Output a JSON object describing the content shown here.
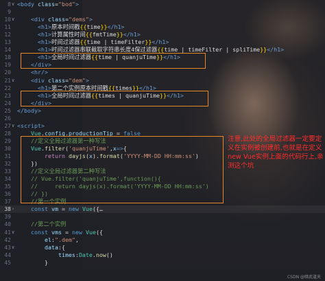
{
  "editor": {
    "lines": [
      {
        "n": "8",
        "fold": "∨",
        "segs": [
          {
            "c": "t",
            "v": "<body"
          },
          {
            "c": "a",
            "v": " class"
          },
          {
            "c": "tx",
            "v": "="
          },
          {
            "c": "s",
            "v": "\"bod\""
          },
          {
            "c": "t",
            "v": ">"
          }
        ]
      },
      {
        "n": "9",
        "fold": "",
        "segs": []
      },
      {
        "n": "10",
        "fold": "∨",
        "segs": [
          {
            "c": "tx",
            "v": "    "
          },
          {
            "c": "t",
            "v": "<div"
          },
          {
            "c": "a",
            "v": " class"
          },
          {
            "c": "tx",
            "v": "="
          },
          {
            "c": "s",
            "v": "\"dems\""
          },
          {
            "c": "t",
            "v": ">"
          }
        ]
      },
      {
        "n": "11",
        "fold": "",
        "segs": [
          {
            "c": "tx",
            "v": "      "
          },
          {
            "c": "t",
            "v": "<h1>"
          },
          {
            "c": "tx",
            "v": "原本时间戳"
          },
          {
            "c": "br",
            "v": "{{"
          },
          {
            "c": "tx",
            "v": "time"
          },
          {
            "c": "br",
            "v": "}}"
          },
          {
            "c": "t",
            "v": "</h1>"
          }
        ]
      },
      {
        "n": "12",
        "fold": "",
        "segs": [
          {
            "c": "tx",
            "v": "      "
          },
          {
            "c": "t",
            "v": "<h1>"
          },
          {
            "c": "tx",
            "v": "计算属性时间"
          },
          {
            "c": "br",
            "v": "{{"
          },
          {
            "c": "tx",
            "v": "fmtTime"
          },
          {
            "c": "br",
            "v": "}}"
          },
          {
            "c": "t",
            "v": "</h1>"
          }
        ]
      },
      {
        "n": "13",
        "fold": "",
        "segs": [
          {
            "c": "tx",
            "v": "      "
          },
          {
            "c": "t",
            "v": "<h1>"
          },
          {
            "c": "tx",
            "v": "时间过滤器"
          },
          {
            "c": "br",
            "v": "{{"
          },
          {
            "c": "tx",
            "v": "time | timeFilter"
          },
          {
            "c": "br",
            "v": "}}"
          },
          {
            "c": "t",
            "v": "</h1>"
          }
        ]
      },
      {
        "n": "14",
        "fold": "",
        "segs": [
          {
            "c": "tx",
            "v": "      "
          },
          {
            "c": "t",
            "v": "<h1>"
          },
          {
            "c": "tx",
            "v": "时间过滤器串联截取字符串长度4保过滤器"
          },
          {
            "c": "br",
            "v": "{{"
          },
          {
            "c": "tx",
            "v": "time | timeFilter | spliTime"
          },
          {
            "c": "br",
            "v": "}}"
          },
          {
            "c": "t",
            "v": "</h1>"
          }
        ]
      },
      {
        "n": "18",
        "fold": "",
        "segs": [
          {
            "c": "tx",
            "v": "      "
          },
          {
            "c": "t",
            "v": "<h1>"
          },
          {
            "c": "tx",
            "v": "全局时间过滤器"
          },
          {
            "c": "br",
            "v": "{{"
          },
          {
            "c": "tx",
            "v": "time | quanjuTime"
          },
          {
            "c": "br",
            "v": "}}"
          },
          {
            "c": "t",
            "v": "</h1>"
          }
        ]
      },
      {
        "n": "19",
        "fold": "",
        "segs": [
          {
            "c": "tx",
            "v": "    "
          },
          {
            "c": "t",
            "v": "</div>"
          }
        ]
      },
      {
        "n": "20",
        "fold": "",
        "segs": [
          {
            "c": "tx",
            "v": "    "
          },
          {
            "c": "t",
            "v": "<hr/>"
          }
        ]
      },
      {
        "n": "21",
        "fold": "∨",
        "segs": [
          {
            "c": "tx",
            "v": "    "
          },
          {
            "c": "t",
            "v": "<div"
          },
          {
            "c": "a",
            "v": " class"
          },
          {
            "c": "tx",
            "v": "="
          },
          {
            "c": "s",
            "v": "\"dem\""
          },
          {
            "c": "t",
            "v": ">"
          }
        ]
      },
      {
        "n": "22",
        "fold": "",
        "segs": [
          {
            "c": "tx",
            "v": "      "
          },
          {
            "c": "t",
            "v": "<h1>"
          },
          {
            "c": "tx",
            "v": "第二个实例原本时间戳"
          },
          {
            "c": "br",
            "v": "{{"
          },
          {
            "c": "tx",
            "v": "times"
          },
          {
            "c": "br",
            "v": "}}"
          },
          {
            "c": "t",
            "v": "</h1>"
          }
        ]
      },
      {
        "n": "23",
        "fold": "",
        "segs": [
          {
            "c": "tx",
            "v": "      "
          },
          {
            "c": "t",
            "v": "<h1>"
          },
          {
            "c": "tx",
            "v": "全局时间过滤器"
          },
          {
            "c": "br",
            "v": "{{"
          },
          {
            "c": "tx",
            "v": "times | quanjuTime"
          },
          {
            "c": "br",
            "v": "}}"
          },
          {
            "c": "t",
            "v": "</h1>"
          }
        ]
      },
      {
        "n": "24",
        "fold": "",
        "segs": [
          {
            "c": "tx",
            "v": "    "
          },
          {
            "c": "t",
            "v": "</div>"
          }
        ]
      },
      {
        "n": "25",
        "fold": "",
        "segs": [
          {
            "c": "t",
            "v": "</body>"
          }
        ]
      },
      {
        "n": "26",
        "fold": "",
        "segs": []
      },
      {
        "n": "27",
        "fold": "∨",
        "segs": [
          {
            "c": "t",
            "v": "<script>"
          }
        ]
      },
      {
        "n": "28",
        "fold": "",
        "segs": [
          {
            "c": "tx",
            "v": "    "
          },
          {
            "c": "cls",
            "v": "Vue"
          },
          {
            "c": "tx",
            "v": "."
          },
          {
            "c": "a",
            "v": "config"
          },
          {
            "c": "tx",
            "v": "."
          },
          {
            "c": "a",
            "v": "productionTip"
          },
          {
            "c": "tx",
            "v": " = "
          },
          {
            "c": "kw",
            "v": "false"
          }
        ]
      },
      {
        "n": "29",
        "fold": "",
        "segs": [
          {
            "c": "tx",
            "v": "    "
          },
          {
            "c": "cm",
            "v": "//定义全局过滤器第一种写法"
          }
        ]
      },
      {
        "n": "30",
        "fold": "",
        "segs": [
          {
            "c": "tx",
            "v": "    "
          },
          {
            "c": "cls",
            "v": "Vue"
          },
          {
            "c": "tx",
            "v": "."
          },
          {
            "c": "fn",
            "v": "filter"
          },
          {
            "c": "tx",
            "v": "("
          },
          {
            "c": "s",
            "v": "'quanjuTime'"
          },
          {
            "c": "tx",
            "v": ","
          },
          {
            "c": "a",
            "v": "x"
          },
          {
            "c": "kw",
            "v": "=>"
          },
          {
            "c": "tx",
            "v": "{"
          }
        ]
      },
      {
        "n": "31",
        "fold": "",
        "segs": [
          {
            "c": "tx",
            "v": "        "
          },
          {
            "c": "pr",
            "v": "return"
          },
          {
            "c": "tx",
            "v": " "
          },
          {
            "c": "fn",
            "v": "dayjs"
          },
          {
            "c": "tx",
            "v": "("
          },
          {
            "c": "a",
            "v": "x"
          },
          {
            "c": "tx",
            "v": ")."
          },
          {
            "c": "fn",
            "v": "format"
          },
          {
            "c": "tx",
            "v": "("
          },
          {
            "c": "s",
            "v": "'YYYY-MM-DD HH:mm:ss'"
          },
          {
            "c": "tx",
            "v": ")"
          }
        ]
      },
      {
        "n": "32",
        "fold": "",
        "segs": [
          {
            "c": "tx",
            "v": "    })"
          }
        ]
      },
      {
        "n": "33",
        "fold": "",
        "segs": [
          {
            "c": "tx",
            "v": "    "
          },
          {
            "c": "cm",
            "v": "//定义全局过滤器第二种写法"
          }
        ]
      },
      {
        "n": "34",
        "fold": "",
        "segs": [
          {
            "c": "tx",
            "v": "    "
          },
          {
            "c": "cm",
            "v": "// Vue.filter('quanjuTime',function(){"
          }
        ]
      },
      {
        "n": "35",
        "fold": "",
        "segs": [
          {
            "c": "tx",
            "v": "    "
          },
          {
            "c": "cm",
            "v": "//     return dayjs(x).format('YYYY-MM-DD HH:mm:ss')"
          }
        ]
      },
      {
        "n": "36",
        "fold": "",
        "segs": [
          {
            "c": "tx",
            "v": "    "
          },
          {
            "c": "cm",
            "v": "// })"
          }
        ]
      },
      {
        "n": "37",
        "fold": "",
        "segs": [
          {
            "c": "tx",
            "v": "    "
          },
          {
            "c": "cm",
            "v": "//第一个实例"
          }
        ]
      },
      {
        "n": "38",
        "fold": "›",
        "segs": [
          {
            "c": "tx",
            "v": "    "
          },
          {
            "c": "kw",
            "v": "const"
          },
          {
            "c": "tx",
            "v": " "
          },
          {
            "c": "a",
            "v": "vm"
          },
          {
            "c": "tx",
            "v": " = "
          },
          {
            "c": "kw",
            "v": "new"
          },
          {
            "c": "tx",
            "v": " "
          },
          {
            "c": "cls",
            "v": "Vue"
          },
          {
            "c": "tx",
            "v": "({…"
          }
        ]
      },
      {
        "n": "39",
        "fold": "",
        "segs": []
      },
      {
        "n": "40",
        "fold": "",
        "segs": [
          {
            "c": "tx",
            "v": "    "
          },
          {
            "c": "cm",
            "v": "//第二个实例"
          }
        ]
      },
      {
        "n": "41",
        "fold": "∨",
        "segs": [
          {
            "c": "tx",
            "v": "    "
          },
          {
            "c": "kw",
            "v": "const"
          },
          {
            "c": "tx",
            "v": " "
          },
          {
            "c": "a",
            "v": "vms"
          },
          {
            "c": "tx",
            "v": " = "
          },
          {
            "c": "kw",
            "v": "new"
          },
          {
            "c": "tx",
            "v": " "
          },
          {
            "c": "cls",
            "v": "Vue"
          },
          {
            "c": "tx",
            "v": "({"
          }
        ]
      },
      {
        "n": "42",
        "fold": "",
        "segs": [
          {
            "c": "tx",
            "v": "        "
          },
          {
            "c": "a",
            "v": "el"
          },
          {
            "c": "tx",
            "v": ":"
          },
          {
            "c": "s",
            "v": "\".dem\""
          },
          {
            "c": "tx",
            "v": ","
          }
        ]
      },
      {
        "n": "43",
        "fold": "∨",
        "segs": [
          {
            "c": "tx",
            "v": "        "
          },
          {
            "c": "a",
            "v": "data"
          },
          {
            "c": "tx",
            "v": ":{"
          }
        ]
      },
      {
        "n": "44",
        "fold": "",
        "segs": [
          {
            "c": "tx",
            "v": "            "
          },
          {
            "c": "a",
            "v": "times"
          },
          {
            "c": "tx",
            "v": ":"
          },
          {
            "c": "cls",
            "v": "Date"
          },
          {
            "c": "tx",
            "v": "."
          },
          {
            "c": "fn",
            "v": "now"
          },
          {
            "c": "tx",
            "v": "()"
          }
        ]
      },
      {
        "n": "45",
        "fold": "",
        "segs": [
          {
            "c": "tx",
            "v": "        }"
          }
        ]
      }
    ]
  },
  "annotation": {
    "text": "注意,此处的全局过滤器一定要定义在实例被创建前,也就是在定义new Vue实例上面的代码行上,亲测这个坑"
  },
  "watermark": "CSDN @暗武逢天",
  "colors": {
    "background": "#1f2026",
    "highlight_box": "#e8872a",
    "annotation_text": "#ff2d2d"
  }
}
